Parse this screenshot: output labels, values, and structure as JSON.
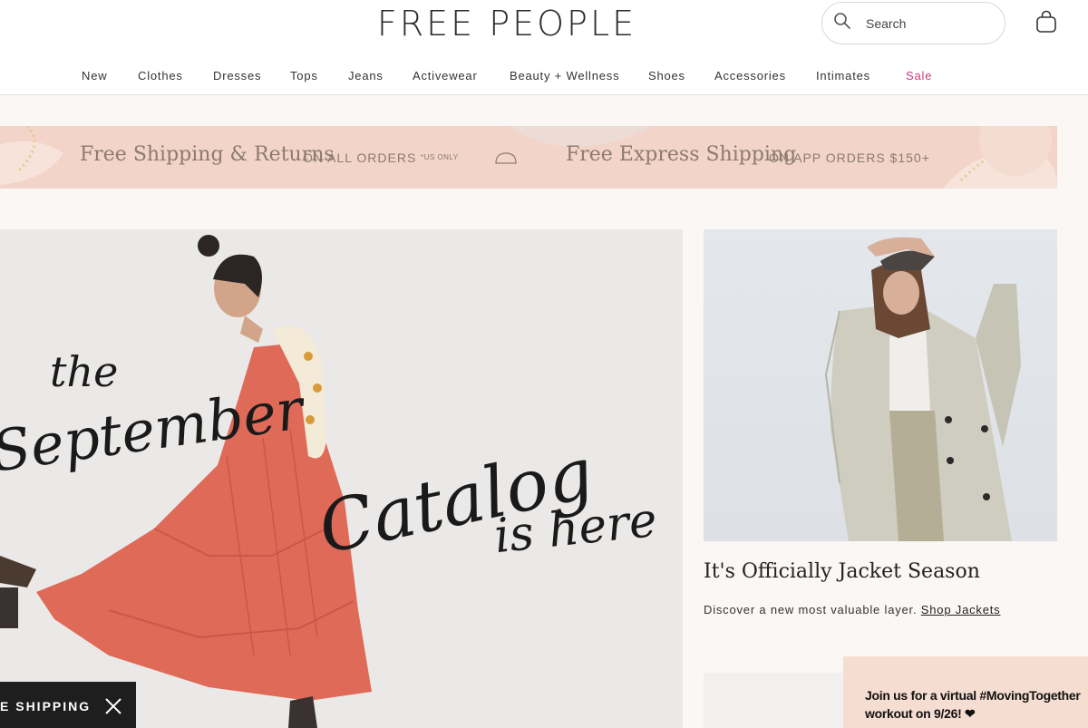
{
  "header": {
    "logo": "FREE PEOPLE",
    "search": {
      "placeholder": "Search"
    },
    "icons": {
      "search": "search-icon",
      "bag": "shopping-bag-icon"
    }
  },
  "nav": {
    "items": [
      "New",
      "Clothes",
      "Dresses",
      "Tops",
      "Jeans",
      "Activewear",
      "Beauty + Wellness",
      "Shoes",
      "Accessories",
      "Intimates",
      "Sale"
    ]
  },
  "promo": {
    "left_title": "Free Shipping & Returns",
    "left_sub": "ON ALL ORDERS",
    "left_note": "*US ONLY",
    "right_title": "Free Express Shipping",
    "right_sub": "ON APP ORDERS $150+"
  },
  "hero": {
    "line1": "the",
    "line2": "September",
    "line3": "Catalog",
    "line4": "is here"
  },
  "feature": {
    "title": "It's Officially Jacket Season",
    "desc": "Discover a new most valuable layer.",
    "link": "Shop Jackets"
  },
  "shipbar": {
    "label": "E SHIPPING"
  },
  "popup": {
    "text": "Join us for a virtual #MovingTogether workout on 9/26! ❤"
  },
  "colors": {
    "sale": "#c93d7c",
    "promo_bg": "#f2d4c8",
    "popup_bg": "#f6ddd1",
    "page_bg": "#faf7f4"
  }
}
